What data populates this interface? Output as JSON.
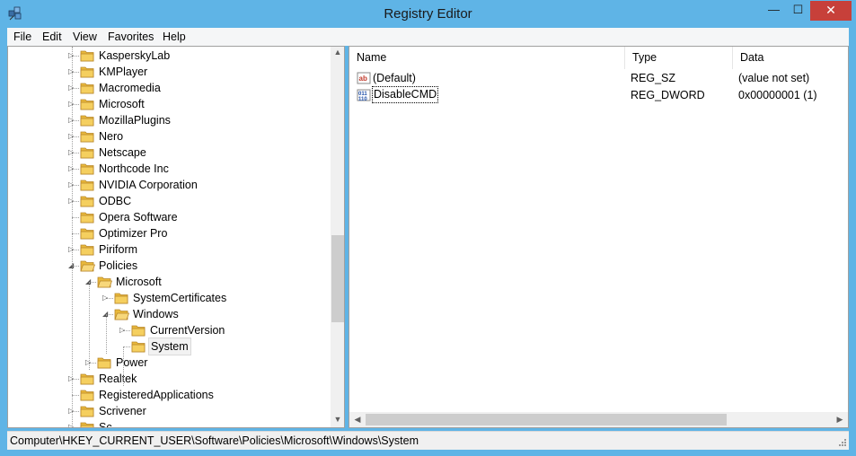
{
  "window": {
    "title": "Registry Editor",
    "minimize_label": "—",
    "maximize_label": "☐",
    "close_label": "✕"
  },
  "menu": [
    "File",
    "Edit",
    "View",
    "Favorites",
    "Help"
  ],
  "tree": [
    {
      "label": "KasperskyLab",
      "expandable": true
    },
    {
      "label": "KMPlayer",
      "expandable": true
    },
    {
      "label": "Macromedia",
      "expandable": true
    },
    {
      "label": "Microsoft",
      "expandable": true
    },
    {
      "label": "MozillaPlugins",
      "expandable": true
    },
    {
      "label": "Nero",
      "expandable": true
    },
    {
      "label": "Netscape",
      "expandable": true
    },
    {
      "label": "Northcode Inc",
      "expandable": true
    },
    {
      "label": "NVIDIA Corporation",
      "expandable": true
    },
    {
      "label": "ODBC",
      "expandable": true
    },
    {
      "label": "Opera Software",
      "expandable": false
    },
    {
      "label": "Optimizer Pro",
      "expandable": false
    },
    {
      "label": "Piriform",
      "expandable": true
    },
    {
      "label": "Policies",
      "expandable": true,
      "expanded": true
    },
    {
      "label": "Microsoft",
      "expandable": true,
      "expanded": true
    },
    {
      "label": "SystemCertificates",
      "expandable": true
    },
    {
      "label": "Windows",
      "expandable": true,
      "expanded": true
    },
    {
      "label": "CurrentVersion",
      "expandable": true
    },
    {
      "label": "System",
      "expandable": false,
      "selected": true
    },
    {
      "label": "Power",
      "expandable": true
    },
    {
      "label": "Realtek",
      "expandable": true
    },
    {
      "label": "RegisteredApplications",
      "expandable": false
    },
    {
      "label": "Scrivener",
      "expandable": true
    },
    {
      "label": "Sc...",
      "expandable": true
    }
  ],
  "columns": [
    "Name",
    "Type",
    "Data"
  ],
  "values": [
    {
      "name": "(Default)",
      "type": "REG_SZ",
      "data": "(value not set)",
      "icon": "string-value-icon"
    },
    {
      "name": "DisableCMD",
      "type": "REG_DWORD",
      "data": "0x00000001 (1)",
      "icon": "binary-value-icon"
    }
  ],
  "status": {
    "path": "Computer\\HKEY_CURRENT_USER\\Software\\Policies\\Microsoft\\Windows\\System"
  },
  "colors": {
    "titlebar": "#5fb4e6",
    "close_button": "#c7403a",
    "folder": "#f2c44d"
  }
}
